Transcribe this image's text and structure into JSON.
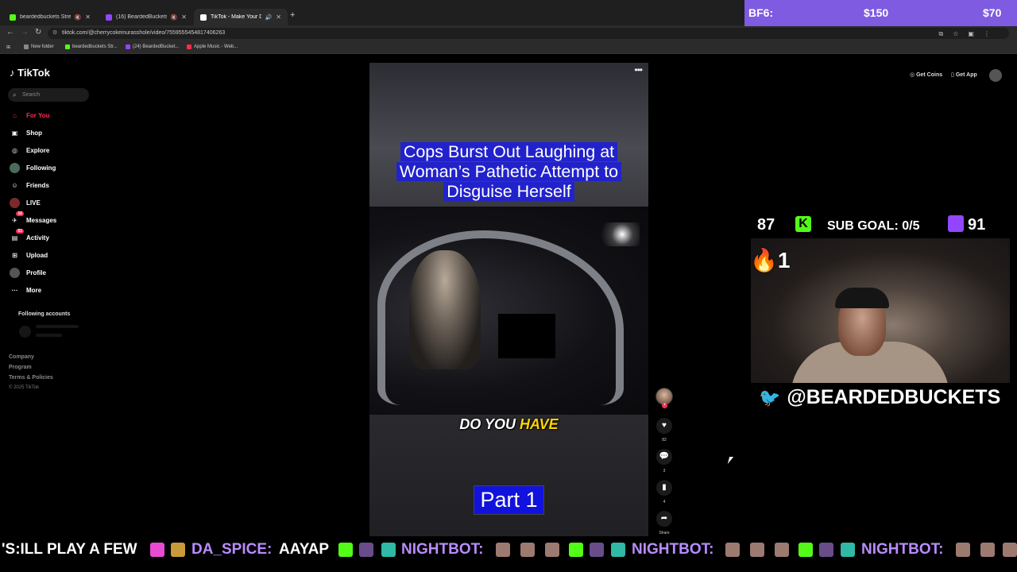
{
  "browser": {
    "tabs": [
      {
        "title": "beardedbuckets Stream - Vi",
        "color": "#53fc18"
      },
      {
        "title": "(16) BeardedBuckets - Twitch",
        "color": "#9146ff"
      },
      {
        "title": "TikTok - Make Your Day",
        "color": "#ffffff"
      }
    ],
    "url": "tiktok.com/@cherrycokeinurasshole/video/7559555454817406263",
    "bookmarks": [
      "New folder",
      "beardedbuckets Str...",
      "(24) BeardedBucket...",
      "Apple Music - Web..."
    ]
  },
  "tiktok": {
    "logo": "TikTok",
    "search_placeholder": "Search",
    "nav": [
      {
        "label": "For You",
        "icon": "home-icon",
        "glyph": "⌂"
      },
      {
        "label": "Shop",
        "icon": "shop-icon",
        "glyph": "▣"
      },
      {
        "label": "Explore",
        "icon": "compass-icon",
        "glyph": "◎"
      },
      {
        "label": "Following",
        "icon": "following-avatar-icon",
        "glyph": "●"
      },
      {
        "label": "Friends",
        "icon": "friends-icon",
        "glyph": "☺"
      },
      {
        "label": "LIVE",
        "icon": "live-avatar-icon",
        "glyph": "●"
      },
      {
        "label": "Messages",
        "icon": "messages-icon",
        "glyph": "✈",
        "badge": "16"
      },
      {
        "label": "Activity",
        "icon": "activity-icon",
        "glyph": "▤",
        "badge": "51"
      },
      {
        "label": "Upload",
        "icon": "upload-icon",
        "glyph": "⊞"
      },
      {
        "label": "Profile",
        "icon": "profile-avatar-icon",
        "glyph": "●"
      },
      {
        "label": "More",
        "icon": "more-icon",
        "glyph": "···"
      }
    ],
    "following_accounts": "Following accounts",
    "footer": [
      "Company",
      "Program",
      "Terms & Policies"
    ],
    "copyright": "© 2025 TikTok",
    "get_coins": "Get Coins",
    "get_app": "Get App",
    "video": {
      "headline": "Cops Burst Out Laughing at Woman’s Pathetic Attempt to Disguise Herself",
      "caption_plain": "DO YOU ",
      "caption_highlight": "HAVE",
      "part_label": "Part 1"
    },
    "actions": {
      "likes": "82",
      "comments": "3",
      "saves": "4",
      "share_label": "Share"
    }
  },
  "overlay": {
    "bf6_label": "BF6:",
    "bf6_amount1": "$150",
    "bf6_amount2": "$70",
    "kick_count": "87",
    "sub_goal": "SUB GOAL: 0/5",
    "twitch_count": "91",
    "fire_count": "1",
    "handle": "@BEARDEDBUCKETS",
    "ticker": [
      {
        "text": "'S:ILL PLAY A FEW",
        "color": "#ffffff"
      },
      {
        "text": "DA_SPICE:",
        "color": "#b98cff"
      },
      {
        "text": "AAYAP",
        "color": "#ffffff"
      },
      {
        "text": "NIGHTBOT:",
        "color": "#b98cff"
      },
      {
        "text": "NIGHTBOT:",
        "color": "#b98cff"
      },
      {
        "text": "NIGHTBOT:",
        "color": "#b98cff"
      }
    ]
  }
}
